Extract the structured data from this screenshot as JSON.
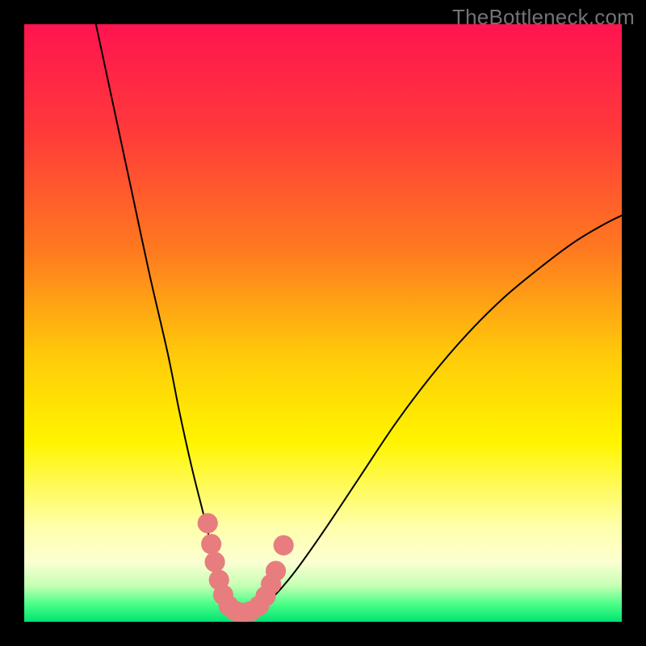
{
  "watermark": "TheBottleneck.com",
  "chart_data": {
    "type": "line",
    "title": "",
    "xlabel": "",
    "ylabel": "",
    "xlim": [
      0,
      100
    ],
    "ylim": [
      0,
      100
    ],
    "gradient_stops": [
      {
        "offset": 0,
        "color": "#ff1450"
      },
      {
        "offset": 18,
        "color": "#ff3a3a"
      },
      {
        "offset": 38,
        "color": "#ff7a1f"
      },
      {
        "offset": 55,
        "color": "#ffc90a"
      },
      {
        "offset": 70,
        "color": "#fff500"
      },
      {
        "offset": 84,
        "color": "#ffffaa"
      },
      {
        "offset": 90,
        "color": "#fcffd2"
      },
      {
        "offset": 94,
        "color": "#c4ffb3"
      },
      {
        "offset": 97,
        "color": "#4cff88"
      },
      {
        "offset": 100,
        "color": "#00e372"
      }
    ],
    "series": [
      {
        "name": "bottleneck-curve",
        "x": [
          12.0,
          15.0,
          18.0,
          21.0,
          24.0,
          26.0,
          28.0,
          30.0,
          31.5,
          33.0,
          34.5,
          36.0,
          38.0,
          41.0,
          45.0,
          50.0,
          56.0,
          62.0,
          68.0,
          74.0,
          80.0,
          86.0,
          92.0,
          97.0,
          100.0
        ],
        "y": [
          100.0,
          86.0,
          72.0,
          58.0,
          45.0,
          35.0,
          26.0,
          18.0,
          12.0,
          7.0,
          3.5,
          1.5,
          1.5,
          3.5,
          8.0,
          15.0,
          24.0,
          33.0,
          41.0,
          48.0,
          54.0,
          59.0,
          63.5,
          66.5,
          68.0
        ]
      }
    ],
    "optimal_zone_markers": {
      "color": "#e77d7e",
      "radius_pct": 1.7,
      "points": [
        {
          "x": 30.7,
          "y": 16.5
        },
        {
          "x": 31.3,
          "y": 13.0
        },
        {
          "x": 31.9,
          "y": 10.0
        },
        {
          "x": 32.6,
          "y": 7.0
        },
        {
          "x": 33.3,
          "y": 4.5
        },
        {
          "x": 34.2,
          "y": 2.7
        },
        {
          "x": 35.3,
          "y": 1.8
        },
        {
          "x": 36.5,
          "y": 1.5
        },
        {
          "x": 38.0,
          "y": 1.8
        },
        {
          "x": 39.3,
          "y": 2.7
        },
        {
          "x": 40.4,
          "y": 4.3
        },
        {
          "x": 41.3,
          "y": 6.3
        },
        {
          "x": 42.1,
          "y": 8.5
        },
        {
          "x": 43.4,
          "y": 12.8
        }
      ]
    }
  }
}
